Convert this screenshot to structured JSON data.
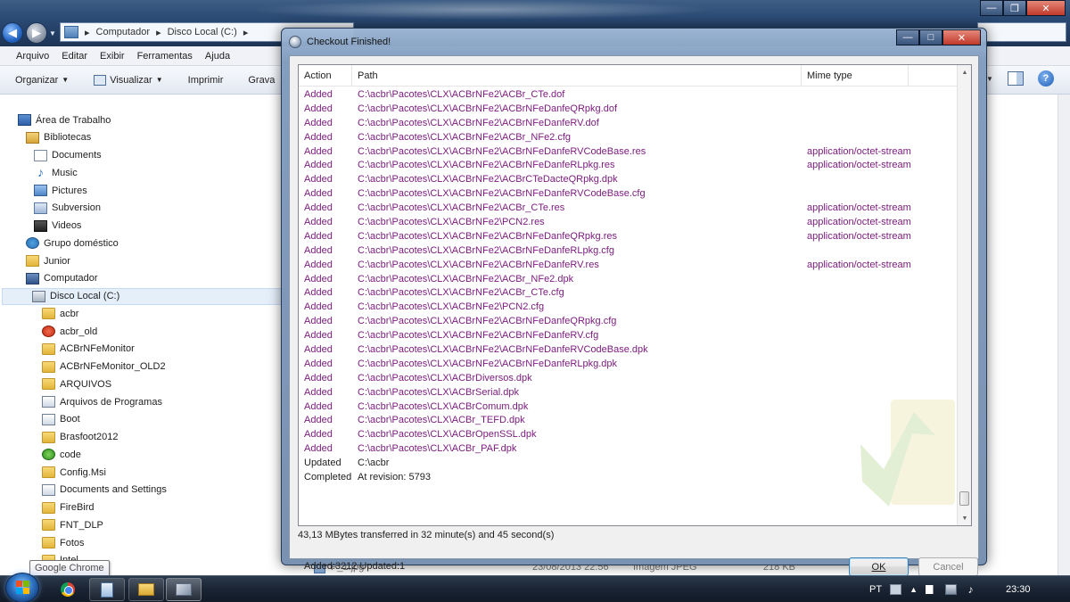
{
  "explorer": {
    "address": [
      "Computador",
      "Disco Local (C:)"
    ],
    "menu": [
      "Arquivo",
      "Editar",
      "Exibir",
      "Ferramentas",
      "Ajuda"
    ],
    "toolbar": {
      "organize": "Organizar",
      "view": "Visualizar",
      "print": "Imprimir",
      "record": "Grava"
    },
    "nav_tree": [
      {
        "label": "Área de Trabalho",
        "icon": "desktop-icon"
      },
      {
        "label": "Bibliotecas",
        "icon": "library-icon"
      },
      {
        "label": "Documents",
        "icon": "documents-icon"
      },
      {
        "label": "Music",
        "icon": "music-icon"
      },
      {
        "label": "Pictures",
        "icon": "pictures-icon"
      },
      {
        "label": "Subversion",
        "icon": "subversion-icon"
      },
      {
        "label": "Videos",
        "icon": "videos-icon"
      },
      {
        "label": "Grupo doméstico",
        "icon": "homegroup-icon"
      },
      {
        "label": "Junior",
        "icon": "user-folder-icon"
      },
      {
        "label": "Computador",
        "icon": "computer-icon"
      },
      {
        "label": "Disco Local (C:)",
        "icon": "drive-icon"
      },
      {
        "label": "acbr",
        "icon": "folder-icon"
      },
      {
        "label": "acbr_old",
        "icon": "folder-error-icon"
      },
      {
        "label": "ACBrNFeMonitor",
        "icon": "folder-icon"
      },
      {
        "label": "ACBrNFeMonitor_OLD2",
        "icon": "folder-icon"
      },
      {
        "label": "ARQUIVOS",
        "icon": "folder-icon"
      },
      {
        "label": "Arquivos de Programas",
        "icon": "shortcut-folder-icon"
      },
      {
        "label": "Boot",
        "icon": "shortcut-folder-icon"
      },
      {
        "label": "Brasfoot2012",
        "icon": "folder-icon"
      },
      {
        "label": "code",
        "icon": "folder-check-icon"
      },
      {
        "label": "Config.Msi",
        "icon": "folder-icon"
      },
      {
        "label": "Documents and Settings",
        "icon": "shortcut-folder-icon"
      },
      {
        "label": "FireBird",
        "icon": "folder-icon"
      },
      {
        "label": "FNT_DLP",
        "icon": "folder-icon"
      },
      {
        "label": "Fotos",
        "icon": "folder-icon"
      },
      {
        "label": "Intel",
        "icon": "folder-icon"
      }
    ],
    "selected_tree_item": "Disco Local (C:)",
    "background_file": {
      "name": "P_1.jpg",
      "date": "23/08/2013 22:56",
      "type": "Imagem JPEG",
      "size": "218 KB"
    }
  },
  "dialog": {
    "title": "Checkout Finished!",
    "columns": [
      "Action",
      "Path",
      "Mime type"
    ],
    "rows": [
      {
        "action": "Added",
        "path": "C:\\acbr\\Pacotes\\CLX\\ACBrNFe2\\ACBr_CTe.dof",
        "mime": ""
      },
      {
        "action": "Added",
        "path": "C:\\acbr\\Pacotes\\CLX\\ACBrNFe2\\ACBrNFeDanfeQRpkg.dof",
        "mime": ""
      },
      {
        "action": "Added",
        "path": "C:\\acbr\\Pacotes\\CLX\\ACBrNFe2\\ACBrNFeDanfeRV.dof",
        "mime": ""
      },
      {
        "action": "Added",
        "path": "C:\\acbr\\Pacotes\\CLX\\ACBrNFe2\\ACBr_NFe2.cfg",
        "mime": ""
      },
      {
        "action": "Added",
        "path": "C:\\acbr\\Pacotes\\CLX\\ACBrNFe2\\ACBrNFeDanfeRVCodeBase.res",
        "mime": "application/octet-stream"
      },
      {
        "action": "Added",
        "path": "C:\\acbr\\Pacotes\\CLX\\ACBrNFe2\\ACBrNFeDanfeRLpkg.res",
        "mime": "application/octet-stream"
      },
      {
        "action": "Added",
        "path": "C:\\acbr\\Pacotes\\CLX\\ACBrNFe2\\ACBrCTeDacteQRpkg.dpk",
        "mime": ""
      },
      {
        "action": "Added",
        "path": "C:\\acbr\\Pacotes\\CLX\\ACBrNFe2\\ACBrNFeDanfeRVCodeBase.cfg",
        "mime": ""
      },
      {
        "action": "Added",
        "path": "C:\\acbr\\Pacotes\\CLX\\ACBrNFe2\\ACBr_CTe.res",
        "mime": "application/octet-stream"
      },
      {
        "action": "Added",
        "path": "C:\\acbr\\Pacotes\\CLX\\ACBrNFe2\\PCN2.res",
        "mime": "application/octet-stream"
      },
      {
        "action": "Added",
        "path": "C:\\acbr\\Pacotes\\CLX\\ACBrNFe2\\ACBrNFeDanfeQRpkg.res",
        "mime": "application/octet-stream"
      },
      {
        "action": "Added",
        "path": "C:\\acbr\\Pacotes\\CLX\\ACBrNFe2\\ACBrNFeDanfeRLpkg.cfg",
        "mime": ""
      },
      {
        "action": "Added",
        "path": "C:\\acbr\\Pacotes\\CLX\\ACBrNFe2\\ACBrNFeDanfeRV.res",
        "mime": "application/octet-stream"
      },
      {
        "action": "Added",
        "path": "C:\\acbr\\Pacotes\\CLX\\ACBrNFe2\\ACBr_NFe2.dpk",
        "mime": ""
      },
      {
        "action": "Added",
        "path": "C:\\acbr\\Pacotes\\CLX\\ACBrNFe2\\ACBr_CTe.cfg",
        "mime": ""
      },
      {
        "action": "Added",
        "path": "C:\\acbr\\Pacotes\\CLX\\ACBrNFe2\\PCN2.cfg",
        "mime": ""
      },
      {
        "action": "Added",
        "path": "C:\\acbr\\Pacotes\\CLX\\ACBrNFe2\\ACBrNFeDanfeQRpkg.cfg",
        "mime": ""
      },
      {
        "action": "Added",
        "path": "C:\\acbr\\Pacotes\\CLX\\ACBrNFe2\\ACBrNFeDanfeRV.cfg",
        "mime": ""
      },
      {
        "action": "Added",
        "path": "C:\\acbr\\Pacotes\\CLX\\ACBrNFe2\\ACBrNFeDanfeRVCodeBase.dpk",
        "mime": ""
      },
      {
        "action": "Added",
        "path": "C:\\acbr\\Pacotes\\CLX\\ACBrNFe2\\ACBrNFeDanfeRLpkg.dpk",
        "mime": ""
      },
      {
        "action": "Added",
        "path": "C:\\acbr\\Pacotes\\CLX\\ACBrDiversos.dpk",
        "mime": ""
      },
      {
        "action": "Added",
        "path": "C:\\acbr\\Pacotes\\CLX\\ACBrSerial.dpk",
        "mime": ""
      },
      {
        "action": "Added",
        "path": "C:\\acbr\\Pacotes\\CLX\\ACBrComum.dpk",
        "mime": ""
      },
      {
        "action": "Added",
        "path": "C:\\acbr\\Pacotes\\CLX\\ACBr_TEFD.dpk",
        "mime": ""
      },
      {
        "action": "Added",
        "path": "C:\\acbr\\Pacotes\\CLX\\ACBrOpenSSL.dpk",
        "mime": ""
      },
      {
        "action": "Added",
        "path": "C:\\acbr\\Pacotes\\CLX\\ACBr_PAF.dpk",
        "mime": ""
      },
      {
        "action": "Updated",
        "path": "C:\\acbr",
        "mime": ""
      },
      {
        "action": "Completed",
        "path": "At revision: 5793",
        "mime": ""
      }
    ],
    "transfer": "43,13 MBytes transferred in 32 minute(s) and 45 second(s)",
    "summary": "Added:3212 Updated:1",
    "ok_label": "OK",
    "cancel_label": "Cancel",
    "added_color": "#7b1a7e"
  },
  "tooltip": "Google Chrome",
  "taskbar": {
    "apps": [
      "chrome-icon",
      "sticky-notes-icon",
      "explorer-icon",
      "tortoisesvn-icon"
    ],
    "language": "PT",
    "time": "23:30"
  }
}
